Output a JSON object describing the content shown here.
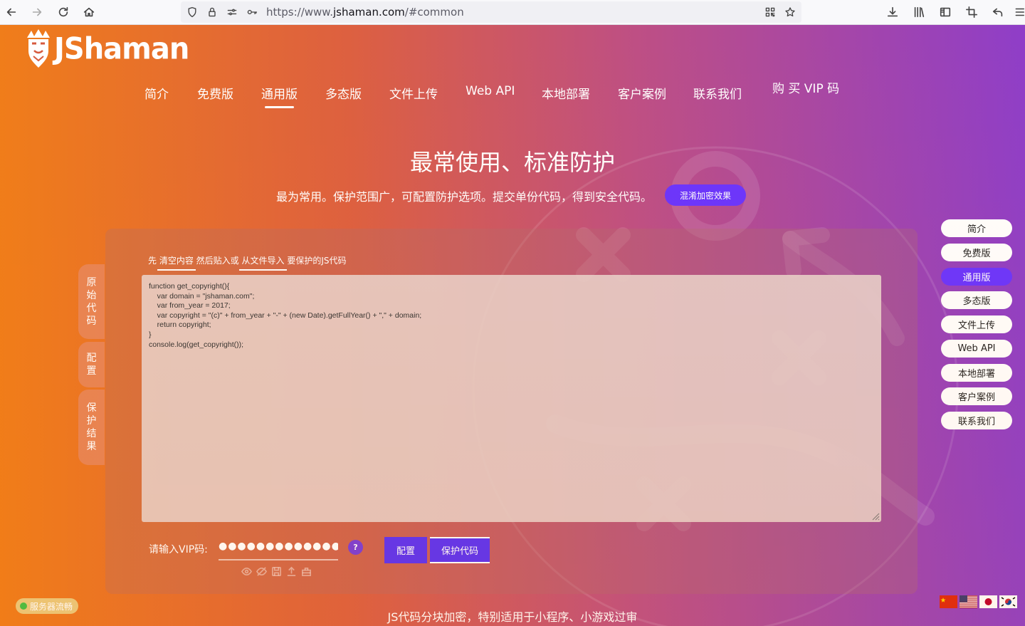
{
  "browser": {
    "url_prefix": "https://www.",
    "url_host": "jshaman.com",
    "url_path": "/#common"
  },
  "brand": {
    "logo_text": "JShaman"
  },
  "nav": {
    "items": [
      "简介",
      "免费版",
      "通用版",
      "多态版",
      "文件上传",
      "Web API",
      "本地部署",
      "客户案例",
      "联系我们",
      "购 买 VIP 码"
    ],
    "active": "通用版"
  },
  "hero": {
    "title": "最常使用、标准防护",
    "subtitle": "最为常用。保护范围广，可配置防护选项。提交单份代码，得到安全代码。",
    "demo_button": "混淆加密效果"
  },
  "side_tabs": [
    "原始代码",
    "配置",
    "保护结果"
  ],
  "instructions": {
    "pre": "先 ",
    "clear": "清空内容",
    "mid": " 然后贴入或 ",
    "import": "从文件导入",
    "post": " 要保护的JS代码"
  },
  "code": "function get_copyright(){\n    var domain = \"jshaman.com\";\n    var from_year = 2017;\n    var copyright = \"(c)\" + from_year + \"-\" + (new Date).getFullYear() + \",\" + domain;\n    return copyright;\n}\nconsole.log(get_copyright());",
  "vip": {
    "label": "请输入VIP码:",
    "value": "●●●●●●●●●●●●●●●●●●●●●●",
    "help": "?",
    "config_button": "配置",
    "protect_button": "保护代码"
  },
  "right_nav": {
    "items": [
      "简介",
      "免费版",
      "通用版",
      "多态版",
      "文件上传",
      "Web API",
      "本地部署",
      "客户案例",
      "联系我们"
    ],
    "active": "通用版"
  },
  "status": "服务器流畅",
  "footer": "JS代码分块加密，特别适用于小程序、小游戏过审",
  "languages": [
    "zh",
    "en",
    "ja",
    "ko"
  ],
  "colors": {
    "accent": "#5c32f4",
    "active_pill": "#6a35ff",
    "status_dot": "#44c044"
  }
}
